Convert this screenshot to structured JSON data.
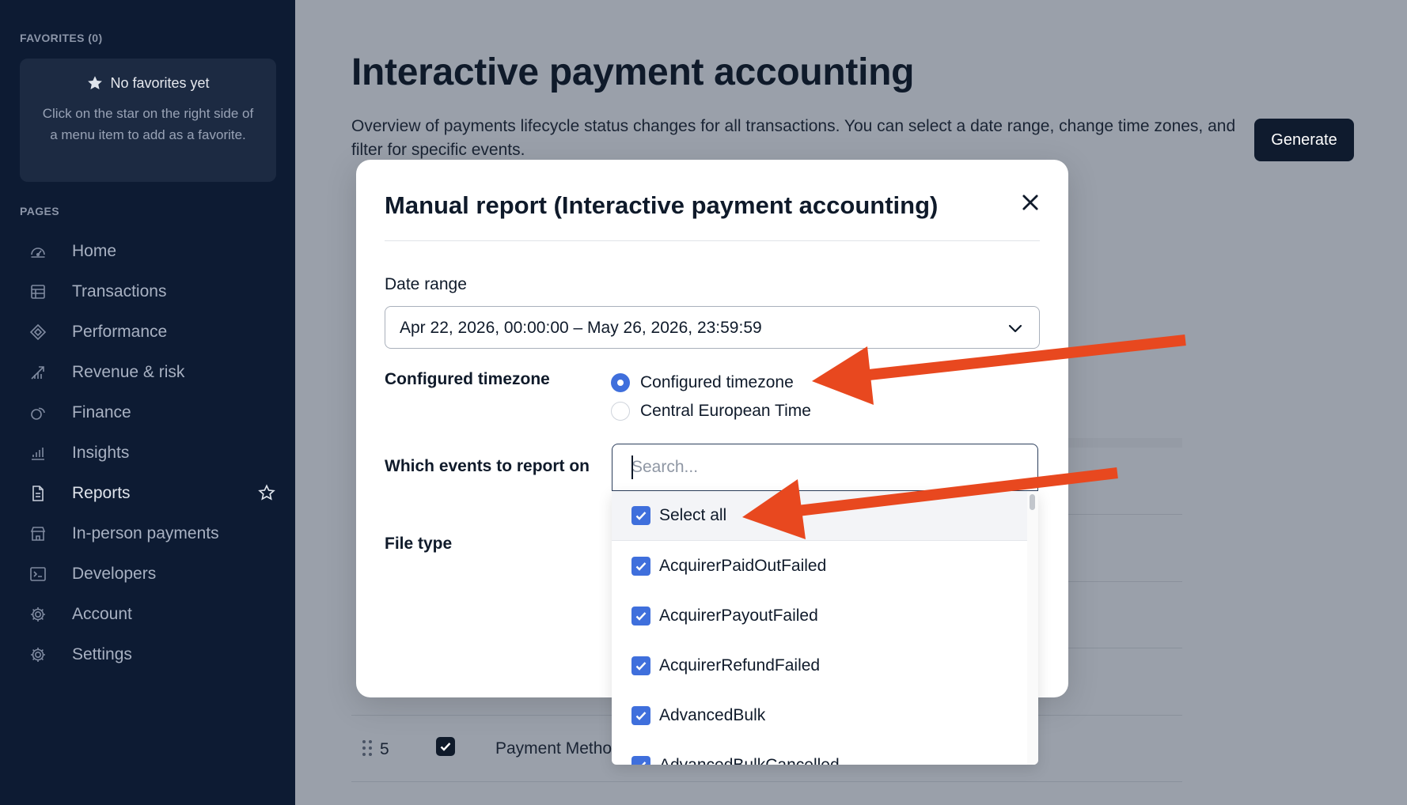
{
  "sidebar": {
    "favorites_heading": "FAVORITES (0)",
    "favorites_empty_title": "No favorites yet",
    "favorites_empty_desc": "Click on the star on the right side of a menu item to add as a favorite.",
    "pages_heading": "PAGES",
    "items": [
      {
        "label": "Home",
        "icon": "speedometer-icon"
      },
      {
        "label": "Transactions",
        "icon": "table-icon"
      },
      {
        "label": "Performance",
        "icon": "diamond-icon"
      },
      {
        "label": "Revenue & risk",
        "icon": "chart-arrow-icon"
      },
      {
        "label": "Finance",
        "icon": "coins-icon"
      },
      {
        "label": "Insights",
        "icon": "bar-chart-icon"
      },
      {
        "label": "Reports",
        "icon": "document-icon",
        "active": true
      },
      {
        "label": "In-person payments",
        "icon": "store-icon"
      },
      {
        "label": "Developers",
        "icon": "terminal-icon"
      },
      {
        "label": "Account",
        "icon": "gear-icon"
      },
      {
        "label": "Settings",
        "icon": "gear-icon"
      }
    ]
  },
  "main": {
    "title": "Interactive payment accounting",
    "description": "Overview of payments lifecycle status changes for all transactions. You can select a date range, change time zones, and filter for specific events.",
    "generate_label": "Generate",
    "background_row": {
      "number": "5",
      "text": "Payment Metho"
    }
  },
  "modal": {
    "title": "Manual report (Interactive payment accounting)",
    "date_range_label": "Date range",
    "date_range_value": "Apr 22, 2026, 00:00:00 – May 26, 2026, 23:59:59",
    "timezone_label": "Configured timezone",
    "timezone_options": [
      {
        "label": "Configured timezone",
        "selected": true
      },
      {
        "label": "Central European Time",
        "selected": false
      }
    ],
    "events_label": "Which events to report on",
    "file_type_label": "File type"
  },
  "events_dropdown": {
    "search_placeholder": "Search...",
    "options": [
      {
        "label": "Select all",
        "checked": true
      },
      {
        "label": "AcquirerPaidOutFailed",
        "checked": true
      },
      {
        "label": "AcquirerPayoutFailed",
        "checked": true
      },
      {
        "label": "AcquirerRefundFailed",
        "checked": true
      },
      {
        "label": "AdvancedBulk",
        "checked": true
      },
      {
        "label": "AdvancedBulkCancelled",
        "checked": true
      }
    ]
  },
  "colors": {
    "sidebar_bg": "#0d1b33",
    "accent_blue": "#3f6fdc",
    "annotation_arrow": "#e8481f",
    "primary_button": "#0f1b2e"
  }
}
